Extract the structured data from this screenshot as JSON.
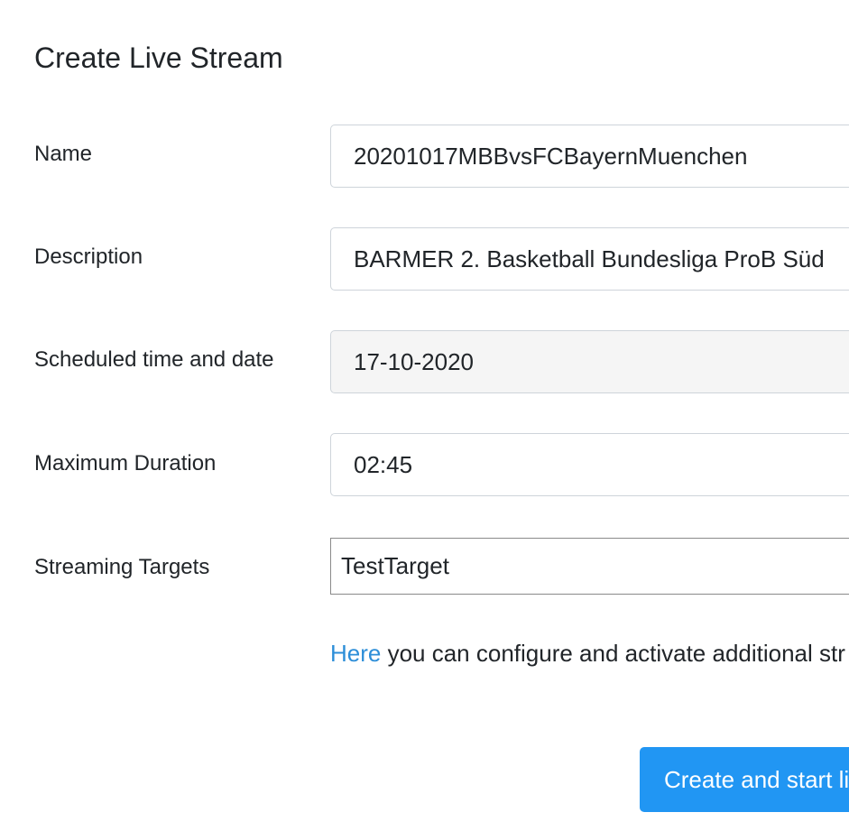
{
  "form": {
    "title": "Create Live Stream",
    "name": {
      "label": "Name",
      "value": "20201017MBBvsFCBayernMuenchen"
    },
    "description": {
      "label": "Description",
      "value": "BARMER 2. Basketball Bundesliga ProB Süd"
    },
    "scheduled": {
      "label": "Scheduled time and date",
      "value": "17-10-2020"
    },
    "duration": {
      "label": "Maximum Duration",
      "value": "02:45"
    },
    "targets": {
      "label": "Streaming Targets",
      "selected": "TestTarget"
    },
    "help": {
      "link_text": "Here",
      "text": " you can configure and activate additional str"
    },
    "submit_label": "Create and start li"
  },
  "colors": {
    "link": "#2d8ed8",
    "primary_button": "#2196f3",
    "readonly_field": "#f5f5f5",
    "field_border": "#ced4da"
  }
}
